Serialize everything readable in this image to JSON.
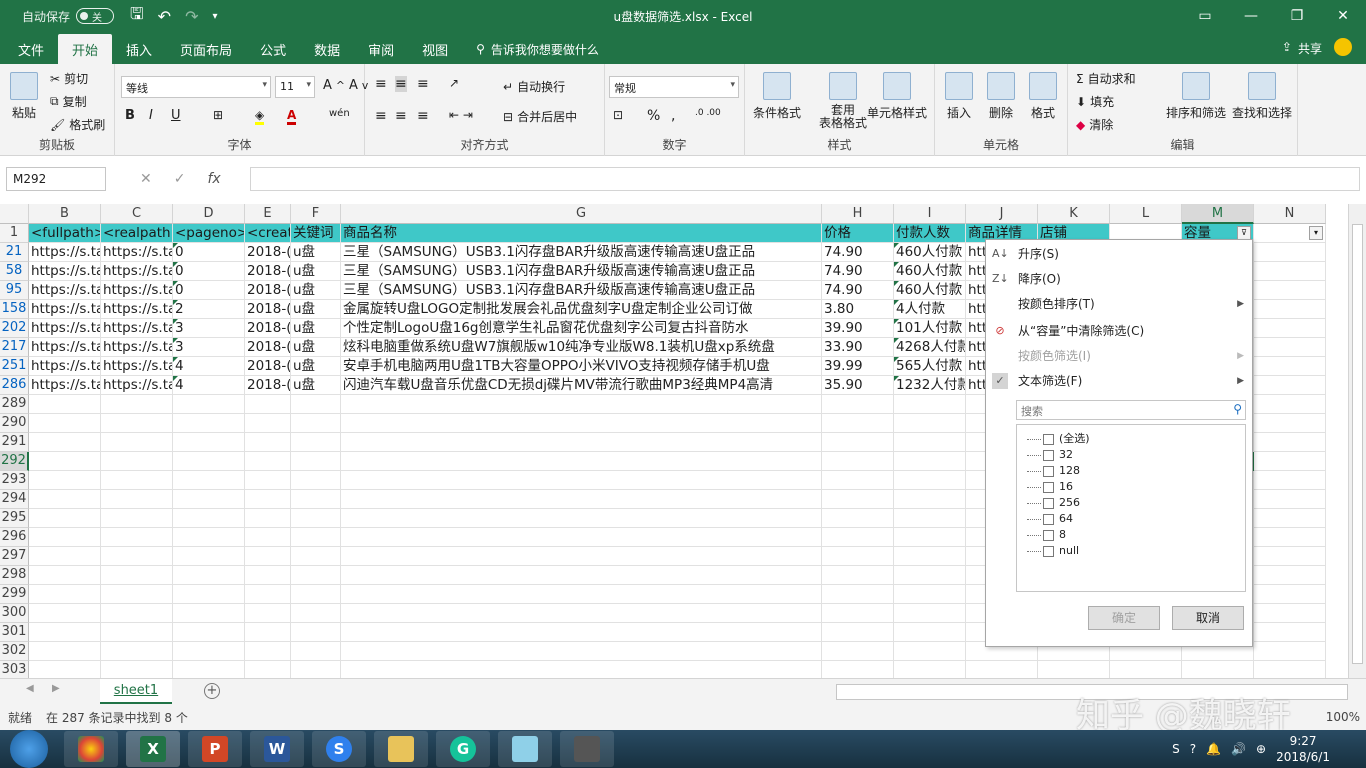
{
  "window": {
    "title": "u盘数据筛选.xlsx - Excel",
    "autosave_label": "自动保存",
    "autosave_state": "关"
  },
  "tabs": [
    "文件",
    "开始",
    "插入",
    "页面布局",
    "公式",
    "数据",
    "审阅",
    "视图"
  ],
  "tellme": "告诉我你想要做什么",
  "share": "共享",
  "ribbon": {
    "clipboard": {
      "label": "剪贴板",
      "paste": "粘贴",
      "cut": "剪切",
      "copy": "复制",
      "format_painter": "格式刷"
    },
    "font": {
      "label": "字体",
      "font_name": "等线",
      "font_size": "11"
    },
    "alignment": {
      "label": "对齐方式",
      "wrap": "自动换行",
      "merge": "合并后居中"
    },
    "number": {
      "label": "数字",
      "format": "常规"
    },
    "styles": {
      "label": "样式",
      "conditional": "条件格式",
      "table": "套用\n表格格式",
      "cell_styles": "单元格样式"
    },
    "cells": {
      "label": "单元格",
      "insert": "插入",
      "delete": "删除",
      "format": "格式"
    },
    "editing": {
      "label": "编辑",
      "autosum": "自动求和",
      "fill": "填充",
      "clear": "清除",
      "sort_filter": "排序和筛选",
      "find_select": "查找和选择"
    }
  },
  "formula_bar": {
    "name_box": "M292",
    "fx": "fx",
    "value": ""
  },
  "columns": [
    "B",
    "C",
    "D",
    "E",
    "F",
    "G",
    "H",
    "I",
    "J",
    "K",
    "L",
    "M",
    "N"
  ],
  "header_row": {
    "row": "1",
    "cells": [
      "<fullpath>",
      "<realpath>",
      "<pageno>",
      "<creat",
      "关键词",
      "商品名称",
      "价格",
      "付款人数",
      "商品详情",
      "店铺",
      "",
      "容量",
      ""
    ]
  },
  "data_rows": [
    {
      "row": "21",
      "cells": [
        "https://s.ta",
        "https://s.ta",
        "0",
        "2018-(",
        "u盘",
        "三星（SAMSUNG）USB3.1闪存盘BAR升级版高速传输高速U盘正品",
        "74.90",
        "460人付款",
        "htt"
      ]
    },
    {
      "row": "58",
      "cells": [
        "https://s.ta",
        "https://s.ta",
        "0",
        "2018-(",
        "u盘",
        "三星（SAMSUNG）USB3.1闪存盘BAR升级版高速传输高速U盘正品",
        "74.90",
        "460人付款",
        "htt"
      ]
    },
    {
      "row": "95",
      "cells": [
        "https://s.ta",
        "https://s.ta",
        "0",
        "2018-(",
        "u盘",
        "三星（SAMSUNG）USB3.1闪存盘BAR升级版高速传输高速U盘正品",
        "74.90",
        "460人付款",
        "htt"
      ]
    },
    {
      "row": "158",
      "cells": [
        "https://s.ta",
        "https://s.ta",
        "2",
        "2018-(",
        "u盘",
        "金属旋转U盘LOGO定制批发展会礼品优盘刻字U盘定制企业公司订做",
        "3.80",
        "4人付款",
        "htt"
      ]
    },
    {
      "row": "202",
      "cells": [
        "https://s.ta",
        "https://s.ta",
        "3",
        "2018-(",
        "u盘",
        "个性定制LogoU盘16g创意学生礼品窗花优盘刻字公司复古抖音防水",
        "39.90",
        "101人付款",
        "htt"
      ]
    },
    {
      "row": "217",
      "cells": [
        "https://s.ta",
        "https://s.ta",
        "3",
        "2018-(",
        "u盘",
        "炫科电脑重做系统U盘W7旗舰版w10纯净专业版W8.1装机U盘xp系统盘",
        "33.90",
        "4268人付款",
        "htt"
      ]
    },
    {
      "row": "251",
      "cells": [
        "https://s.ta",
        "https://s.ta",
        "4",
        "2018-(",
        "u盘",
        "安卓手机电脑两用U盘1TB大容量OPPO小米VIVO支持视频存储手机U盘",
        "39.99",
        "565人付款",
        "htt"
      ]
    },
    {
      "row": "286",
      "cells": [
        "https://s.ta",
        "https://s.ta",
        "4",
        "2018-(",
        "u盘",
        "闪迪汽车载U盘音乐优盘CD无损dj碟片MV带流行歌曲MP3经典MP4高清",
        "35.90",
        "1232人付款",
        "htt"
      ]
    }
  ],
  "empty_rows": [
    "289",
    "290",
    "291",
    "292",
    "293",
    "294",
    "295",
    "296",
    "297",
    "298",
    "299",
    "300",
    "301",
    "302",
    "303"
  ],
  "filter_menu": {
    "sort_asc": "升序(S)",
    "sort_desc": "降序(O)",
    "sort_by_color": "按颜色排序(T)",
    "clear_filter": "从“容量”中清除筛选(C)",
    "filter_by_color": "按颜色筛选(I)",
    "text_filters": "文本筛选(F)",
    "search_placeholder": "搜索",
    "values": [
      "(全选)",
      "32",
      "128",
      "16",
      "256",
      "64",
      "8",
      "null"
    ],
    "ok": "确定",
    "cancel": "取消"
  },
  "sheet_tab": "sheet1",
  "status": {
    "mode": "就绪",
    "summary": "在 287 条记录中找到 8 个",
    "zoom": "100%"
  },
  "watermark": "知乎 @魏晓轩",
  "taskbar": {
    "time": "9:27",
    "date": "2018/6/1"
  },
  "colors": {
    "excel_green": "#217346",
    "header_fill": "#3fc8c8"
  }
}
